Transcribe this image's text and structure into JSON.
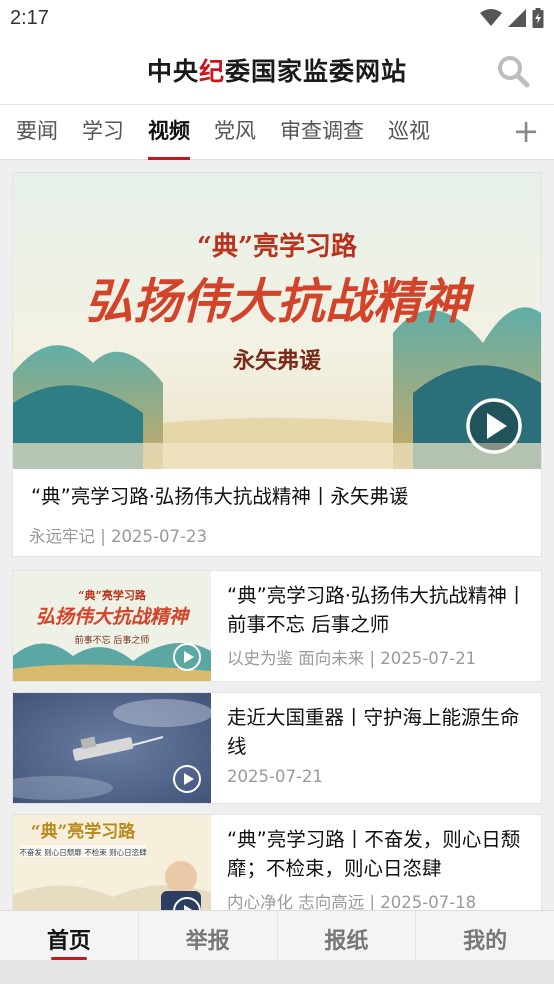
{
  "status_bar": {
    "time": "2:17"
  },
  "header": {
    "logo_pre": "中央",
    "logo_accent": "纪",
    "logo_post": "委国家监委网站",
    "accent_color": "#c8161d"
  },
  "tabs": [
    {
      "label": "要闻"
    },
    {
      "label": "学习"
    },
    {
      "label": "视频"
    },
    {
      "label": "党风"
    },
    {
      "label": "审查调查"
    },
    {
      "label": "巡视"
    }
  ],
  "active_tab": "视频",
  "hero": {
    "image_text": {
      "quote": "“典”亮学习路",
      "calligraphy": "弘扬伟大抗战精神",
      "subtitle": "永矢弗谖"
    },
    "title": "“典”亮学习路·弘扬伟大抗战精神丨永矢弗谖",
    "meta": "永远牢记 | 2025-07-23"
  },
  "cards": [
    {
      "title": "“典”亮学习路·弘扬伟大抗战精神丨前事不忘 后事之师",
      "meta": "以史为鉴 面向未来 | 2025-07-21",
      "thumb_text": {
        "quote": "“典”亮学习路",
        "calligraphy": "弘扬伟大抗战精神",
        "subtitle": "前事不忘  后事之师"
      }
    },
    {
      "title": "走近大国重器丨守护海上能源生命线",
      "meta": "2025-07-21"
    },
    {
      "title": "“典”亮学习路丨不奋发，则心日颓靡；不检束，则心日恣肆",
      "meta": "内心净化 志向高远 | 2025-07-18",
      "thumb_text": {
        "quote": "“典”亮学习路",
        "caption": "不奋发 则心日颓靡 不检束 则心日恣肆"
      }
    }
  ],
  "bottom_nav": [
    {
      "label": "首页"
    },
    {
      "label": "举报"
    },
    {
      "label": "报纸"
    },
    {
      "label": "我的"
    }
  ],
  "active_nav": "首页"
}
